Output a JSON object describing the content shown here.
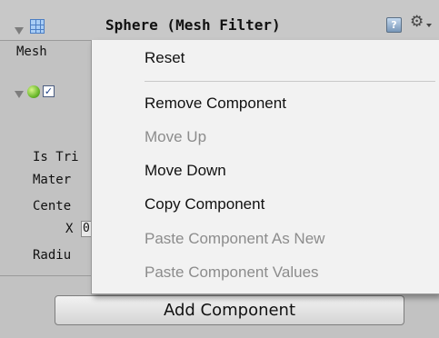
{
  "component": {
    "title": "Sphere (Mesh Filter)",
    "help_glyph": "?",
    "gear_glyph": "⚙",
    "check_glyph": "✓",
    "mesh_label": "Mesh",
    "icons": [
      "mesh-filter-icon",
      "help-icon",
      "gear-icon",
      "sphere-collider-icon"
    ]
  },
  "collider_props": {
    "is_trigger": "Is Tri",
    "material": "Mater",
    "center": "Cente",
    "x_label": "X",
    "x_value_partial": "0",
    "radius": "Radiu"
  },
  "context_menu": {
    "items": [
      {
        "label": "Reset",
        "enabled": true
      },
      {
        "label": "Remove Component",
        "enabled": true
      },
      {
        "label": "Move Up",
        "enabled": false
      },
      {
        "label": "Move Down",
        "enabled": true
      },
      {
        "label": "Copy Component",
        "enabled": true
      },
      {
        "label": "Paste Component As New",
        "enabled": false
      },
      {
        "label": "Paste Component Values",
        "enabled": false
      }
    ]
  },
  "footer": {
    "add_component_label": "Add Component"
  },
  "colors": {
    "inspector_bg": "#c2c2c2",
    "menu_bg": "#f2f2f2",
    "disabled_text": "#8c8c8c"
  }
}
